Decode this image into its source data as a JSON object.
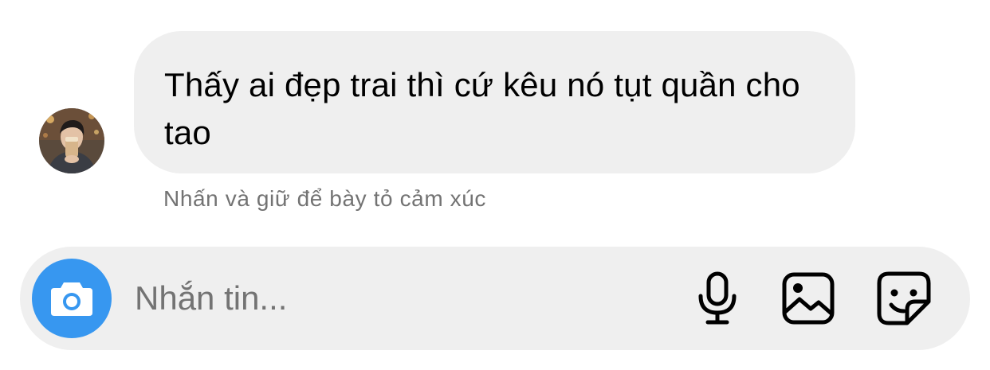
{
  "message": {
    "sender_avatar": "avatar",
    "text": "Thấy ai đẹp trai thì cứ kêu nó tụt quần cho tao",
    "hint": "Nhấn và giữ để bày tỏ cảm xúc"
  },
  "composer": {
    "placeholder": "Nhắn tin...",
    "camera_icon": "camera-icon",
    "mic_icon": "microphone-icon",
    "gallery_icon": "gallery-icon",
    "sticker_icon": "sticker-icon"
  },
  "colors": {
    "bubble_bg": "#efefef",
    "accent": "#3797f0",
    "hint_text": "#737373",
    "text": "#000000"
  }
}
